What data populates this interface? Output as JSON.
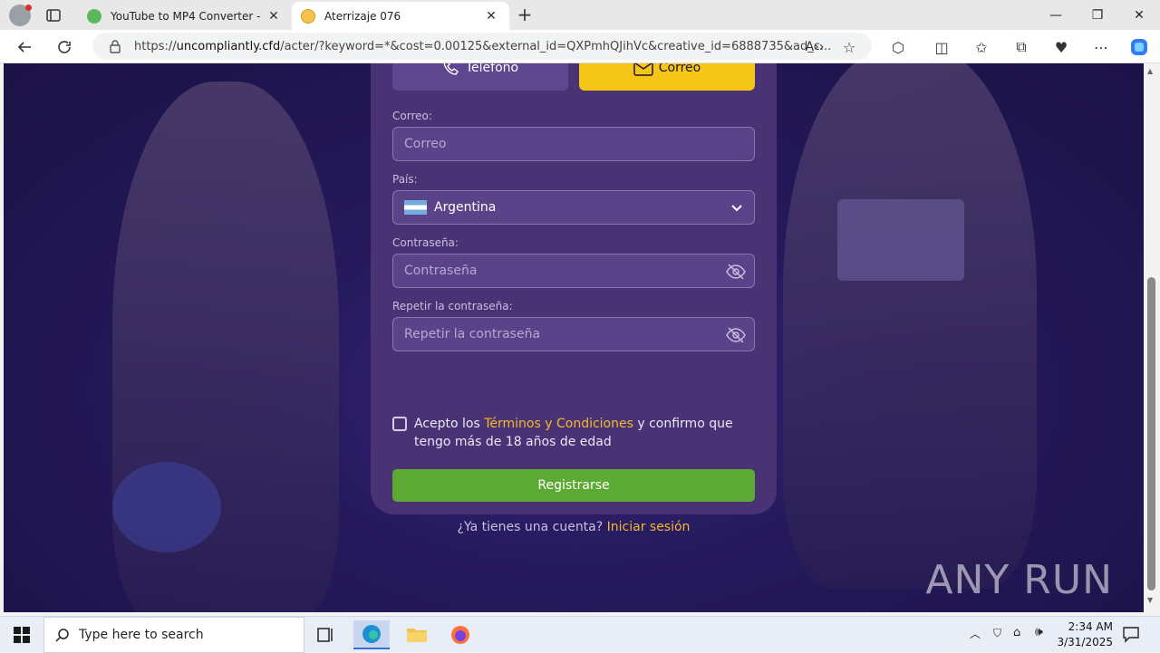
{
  "browser": {
    "tabs": [
      {
        "title": "YouTube to MP4 Converter - Con",
        "active": false
      },
      {
        "title": "Aterrizaje 076",
        "active": true
      }
    ],
    "url_prefix": "https://",
    "url_host": "uncompliantly.cfd",
    "url_path": "/acter/?keyword=*&cost=0.00125&external_id=QXPmhQJihVc&creative_id=6888735&ad_c..."
  },
  "form": {
    "tab_phone": "Teléfono",
    "tab_email": "Correo",
    "email_label": "Correo:",
    "email_placeholder": "Correo",
    "country_label": "País:",
    "country_value": "Argentina",
    "password_label": "Contraseña:",
    "password_placeholder": "Contraseña",
    "repeat_label": "Repetir la contraseña:",
    "repeat_placeholder": "Repetir la contraseña",
    "terms_pre": "Acepto los ",
    "terms_link": "Términos y Condiciones",
    "terms_post": " y confirmo que tengo más de 18 años de edad",
    "register_button": "Registrarse",
    "login_question": "¿Ya tienes una cuenta?",
    "login_link": "Iniciar sesión"
  },
  "watermark": "ANY RUN",
  "taskbar": {
    "search_placeholder": "Type here to search",
    "time": "2:34 AM",
    "date": "3/31/2025"
  },
  "colors": {
    "accent_yellow": "#f5c518",
    "register_green": "#5ca933",
    "panel_purple": "#4a3374",
    "link_orange": "#f5b82e"
  }
}
